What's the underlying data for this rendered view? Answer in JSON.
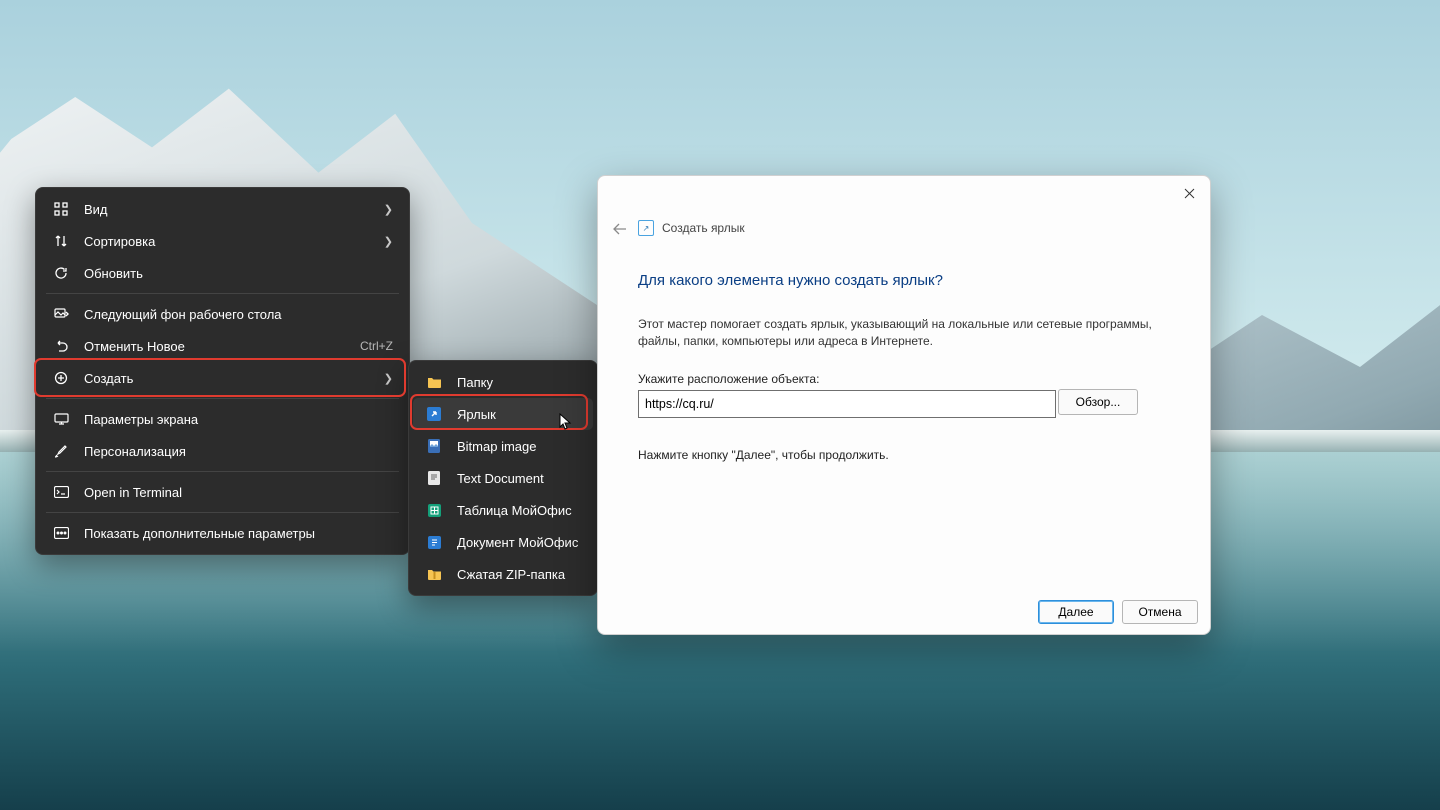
{
  "context_menu": {
    "view": {
      "label": "Вид"
    },
    "sort": {
      "label": "Сортировка"
    },
    "refresh": {
      "label": "Обновить"
    },
    "next_bg": {
      "label": "Следующий фон рабочего стола"
    },
    "undo": {
      "label": "Отменить Новое",
      "shortcut": "Ctrl+Z"
    },
    "create": {
      "label": "Создать"
    },
    "display": {
      "label": "Параметры экрана"
    },
    "personalize": {
      "label": "Персонализация"
    },
    "terminal": {
      "label": "Open in Terminal"
    },
    "more": {
      "label": "Показать дополнительные параметры"
    }
  },
  "submenu": {
    "folder": {
      "label": "Папку"
    },
    "shortcut": {
      "label": "Ярлык"
    },
    "bitmap": {
      "label": "Bitmap image"
    },
    "text": {
      "label": "Text Document"
    },
    "table": {
      "label": "Таблица МойОфис"
    },
    "doc": {
      "label": "Документ МойОфис"
    },
    "zip": {
      "label": "Сжатая ZIP-папка"
    }
  },
  "dialog": {
    "breadcrumb": "Создать ярлык",
    "heading": "Для какого элемента нужно создать ярлык?",
    "description": "Этот мастер помогает создать ярлык, указывающий на локальные или сетевые программы, файлы, папки, компьютеры или адреса в Интернете.",
    "location_label": "Укажите расположение объекта:",
    "location_value": "https://cq.ru/",
    "browse": "Обзор...",
    "hint": "Нажмите кнопку \"Далее\", чтобы продолжить.",
    "next": "Далее",
    "cancel": "Отмена"
  }
}
